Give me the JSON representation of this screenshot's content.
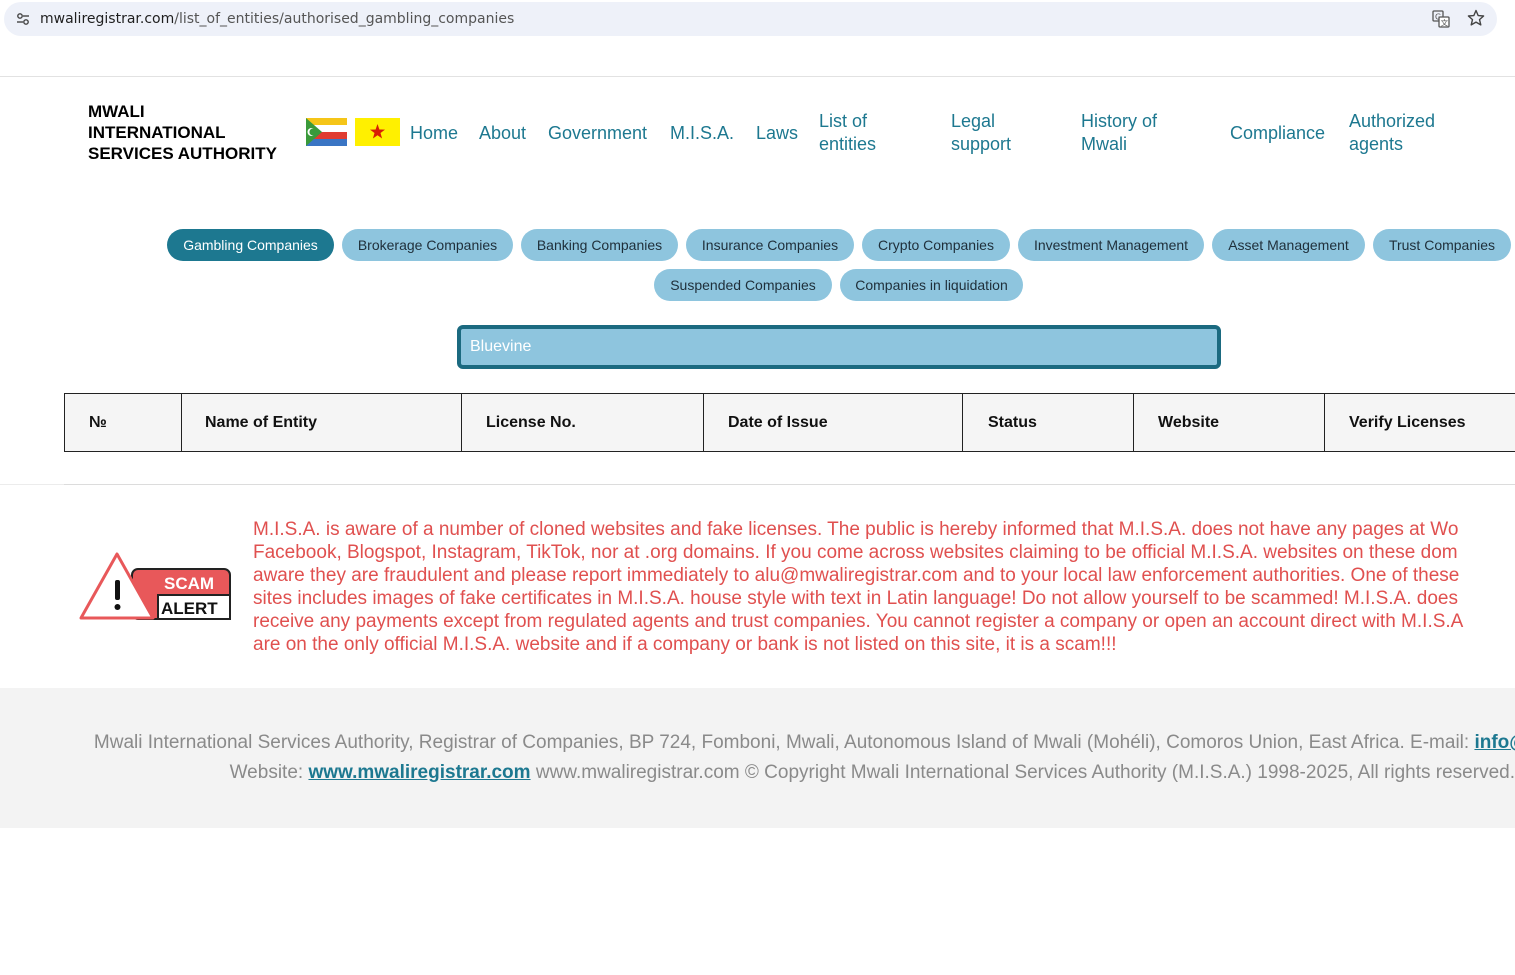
{
  "browser": {
    "url_host": "mwaliregistrar.com",
    "url_path": "/list_of_entities/authorised_gambling_companies"
  },
  "header": {
    "logo_text": "MWALI\nINTERNATIONAL\nSERVICES AUTHORITY",
    "nav": [
      {
        "label": "Home"
      },
      {
        "label": "About"
      },
      {
        "label": "Government"
      },
      {
        "label": "M.I.S.A."
      },
      {
        "label": "Laws"
      },
      {
        "label": "List of entities"
      },
      {
        "label": "Legal support"
      },
      {
        "label": "History of Mwali"
      },
      {
        "label": "Compliance"
      },
      {
        "label": "Authorized agents"
      }
    ]
  },
  "categories": [
    {
      "label": "Gambling Companies",
      "active": true
    },
    {
      "label": "Brokerage Companies"
    },
    {
      "label": "Banking Companies"
    },
    {
      "label": "Insurance Companies"
    },
    {
      "label": "Crypto Companies"
    },
    {
      "label": "Investment Management"
    },
    {
      "label": "Asset Management"
    },
    {
      "label": "Trust Companies"
    },
    {
      "label": "Suspended Companies"
    },
    {
      "label": "Companies in liquidation"
    }
  ],
  "search": {
    "value": "Bluevine"
  },
  "table": {
    "headers": [
      "№",
      "Name of Entity",
      "License No.",
      "Date of Issue",
      "Status",
      "Website",
      "Verify Licenses"
    ],
    "rows": []
  },
  "scam_badge": {
    "line1": "SCAM",
    "line2": "ALERT"
  },
  "warning": {
    "lines": [
      "M.I.S.A. is aware of a number of cloned websites and fake licenses. The public is hereby informed that M.I.S.A. does not have any pages at Wo",
      "Facebook, Blogspot, Instagram, TikTok, nor at .org domains. If you come across websites claiming to be official M.I.S.A. websites on these dom",
      "aware they are fraudulent and please report immediately to alu@mwaliregistrar.com and to your local law enforcement authorities. One of these",
      "sites includes images of fake certificates in M.I.S.A. house style with text in Latin language! Do not allow yourself to be scammed! M.I.S.A. does",
      "receive any payments except from regulated agents and trust companies. You cannot register a company or open an account direct with M.I.S.A",
      "are on the only official M.I.S.A. website and if a company or bank is not listed on this site, it is a scam!!!"
    ]
  },
  "footer": {
    "line1_text": "Mwali International Services Authority, Registrar of Companies, BP 724, Fomboni, Mwali, Autonomous Island of Mwali (Mohéli), Comoros Union, East Africa. E-mail: ",
    "email": "info@mwaliregistrar.com",
    "website_label": "Website: ",
    "website_link": "www.mwaliregistrar.com",
    "copyright": " www.mwaliregistrar.com © Copyright Mwali International Services Authority (M.I.S.A.) 1998-2025, All rights reserved."
  },
  "colors": {
    "accent": "#1d7890",
    "pill": "#8ec5de",
    "warning": "#e0504f"
  }
}
